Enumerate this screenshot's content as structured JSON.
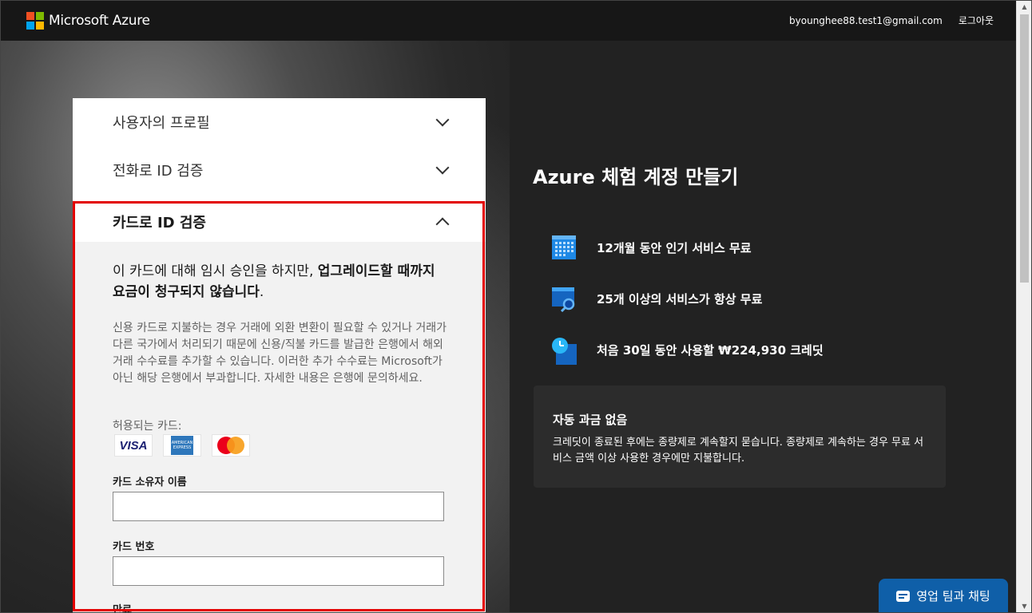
{
  "header": {
    "brand": "Microsoft Azure",
    "user_email": "byounghee88.test1@gmail.com",
    "logout_label": "로그아웃",
    "logo_colors": [
      "#f25022",
      "#7fba00",
      "#00a4ef",
      "#ffb900"
    ]
  },
  "signup_steps": {
    "profile_label": "사용자의 프로필",
    "phone_label": "전화로 ID 검증",
    "card_label": "카드로 ID 검증"
  },
  "card_section": {
    "intro_plain": "이 카드에 대해 임시 승인을 하지만, ",
    "intro_bold": "업그레이드할 때까지 요금이 청구되지 않습니다",
    "intro_end": ".",
    "description": "신용 카드로 지불하는 경우 거래에 외환 변환이 필요할 수 있거나 거래가 다른 국가에서 처리되기 때문에 신용/직불 카드를 발급한 은행에서 해외 거래 수수료를 추가할 수 있습니다. 이러한 추가 수수료는 Microsoft가 아닌 해당 은행에서 부과합니다. 자세한 내용은 은행에 문의하세요.",
    "accepted_cards_label": "허용되는 카드:",
    "accepted_cards": [
      {
        "name": "visa-card-icon",
        "text": "VISA"
      },
      {
        "name": "amex-card-icon",
        "text": "AMERICAN EXPRESS"
      },
      {
        "name": "mastercard-card-icon",
        "text": ""
      }
    ],
    "cardholder_name_label": "카드 소유자 이름",
    "cardholder_name_value": "",
    "card_number_label": "카드 번호",
    "card_number_value": "",
    "expiry_label_partial": "만료"
  },
  "promo": {
    "title": "Azure 체험 계정 만들기",
    "benefits": [
      {
        "icon": "calendar-icon",
        "text": "12개월 동안 인기 서비스 무료"
      },
      {
        "icon": "search-window-icon",
        "text": "25개 이상의 서비스가 항상 무료"
      },
      {
        "icon": "clock-icon",
        "text": "처음 30일 동안 사용할 ₩224,930 크레딧"
      }
    ],
    "info_title": "자동 과금 없음",
    "info_body": "크레딧이 종료된 후에는 종량제로 계속할지 묻습니다. 종량제로 계속하는 경우 무료 서비스 금액 이상 사용한 경우에만 지불합니다."
  },
  "chat": {
    "label": "영업 팀과 채팅",
    "color": "#0f5fa8"
  },
  "colors": {
    "highlight": "#e30000",
    "accent_blue": "#0078d4"
  }
}
